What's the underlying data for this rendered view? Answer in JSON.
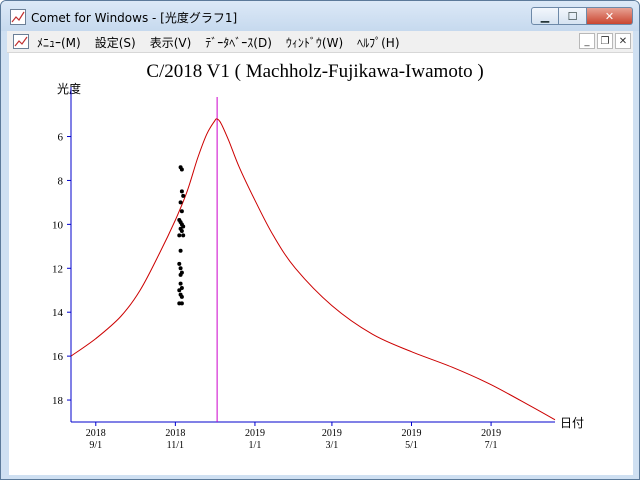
{
  "window": {
    "title": "Comet for Windows - [光度グラフ1]",
    "controls": {
      "minimize": "▁",
      "maximize": "☐",
      "close": "✕"
    },
    "accent_color": "#cfe0f2"
  },
  "menubar": {
    "items": [
      {
        "label": "ﾒﾆｭｰ(M)"
      },
      {
        "label": "設定(S)"
      },
      {
        "label": "表示(V)"
      },
      {
        "label": "ﾃﾞｰﾀﾍﾞｰｽ(D)"
      },
      {
        "label": "ｳｨﾝﾄﾞｳ(W)"
      },
      {
        "label": "ﾍﾙﾌﾟ(H)"
      }
    ],
    "mdi_controls": {
      "minimize": "_",
      "restore": "❐",
      "close": "✕"
    }
  },
  "chart_data": {
    "type": "line",
    "title": "C/2018 V1 ( Machholz-Fujikawa-Iwamoto )",
    "ylabel": "光度",
    "xlabel": "日付",
    "y_reversed": true,
    "ylim": [
      4.2,
      19
    ],
    "xlim": [
      "2018-08-13",
      "2019-08-19"
    ],
    "y_ticks": [
      6,
      8,
      10,
      12,
      14,
      16,
      18
    ],
    "x_ticks": [
      {
        "date": "2018-09-01",
        "year": "2018",
        "md": "9/1"
      },
      {
        "date": "2018-11-01",
        "year": "2018",
        "md": "11/1"
      },
      {
        "date": "2019-01-01",
        "year": "2019",
        "md": "1/1"
      },
      {
        "date": "2019-03-01",
        "year": "2019",
        "md": "3/1"
      },
      {
        "date": "2019-05-01",
        "year": "2019",
        "md": "5/1"
      },
      {
        "date": "2019-07-01",
        "year": "2019",
        "md": "7/1"
      }
    ],
    "perihelion_date": "2018-12-03",
    "colors": {
      "axis": "#0000cc",
      "curve": "#cc0000",
      "marker_line": "#cc00cc",
      "points": "#000000"
    },
    "series": [
      {
        "kind": "curve",
        "points": [
          [
            "2018-08-13",
            16.0
          ],
          [
            "2018-09-01",
            15.2
          ],
          [
            "2018-09-20",
            14.2
          ],
          [
            "2018-10-05",
            13.0
          ],
          [
            "2018-10-20",
            11.3
          ],
          [
            "2018-11-01",
            9.8
          ],
          [
            "2018-11-10",
            8.5
          ],
          [
            "2018-11-18",
            7.0
          ],
          [
            "2018-11-25",
            5.9
          ],
          [
            "2018-12-01",
            5.3
          ],
          [
            "2018-12-03",
            5.2
          ],
          [
            "2018-12-06",
            5.4
          ],
          [
            "2018-12-12",
            6.2
          ],
          [
            "2018-12-20",
            7.4
          ],
          [
            "2019-01-01",
            8.9
          ],
          [
            "2019-01-15",
            10.5
          ],
          [
            "2019-02-01",
            12.0
          ],
          [
            "2019-03-01",
            13.7
          ],
          [
            "2019-04-01",
            15.0
          ],
          [
            "2019-05-01",
            15.8
          ],
          [
            "2019-06-01",
            16.5
          ],
          [
            "2019-07-01",
            17.3
          ],
          [
            "2019-08-01",
            18.3
          ],
          [
            "2019-08-19",
            18.9
          ]
        ]
      },
      {
        "kind": "observations",
        "points": [
          [
            "2018-11-05",
            7.4
          ],
          [
            "2018-11-06",
            7.5
          ],
          [
            "2018-11-06",
            8.5
          ],
          [
            "2018-11-07",
            8.7
          ],
          [
            "2018-11-05",
            9.0
          ],
          [
            "2018-11-06",
            9.4
          ],
          [
            "2018-11-04",
            9.8
          ],
          [
            "2018-11-05",
            9.9
          ],
          [
            "2018-11-06",
            10.0
          ],
          [
            "2018-11-07",
            10.1
          ],
          [
            "2018-11-05",
            10.2
          ],
          [
            "2018-11-06",
            10.3
          ],
          [
            "2018-11-04",
            10.5
          ],
          [
            "2018-11-07",
            10.5
          ],
          [
            "2018-11-05",
            11.2
          ],
          [
            "2018-11-04",
            11.8
          ],
          [
            "2018-11-05",
            12.0
          ],
          [
            "2018-11-06",
            12.2
          ],
          [
            "2018-11-05",
            12.3
          ],
          [
            "2018-11-05",
            12.7
          ],
          [
            "2018-11-06",
            12.9
          ],
          [
            "2018-11-04",
            13.0
          ],
          [
            "2018-11-05",
            13.2
          ],
          [
            "2018-11-06",
            13.3
          ],
          [
            "2018-11-04",
            13.6
          ],
          [
            "2018-11-06",
            13.6
          ]
        ]
      }
    ]
  }
}
